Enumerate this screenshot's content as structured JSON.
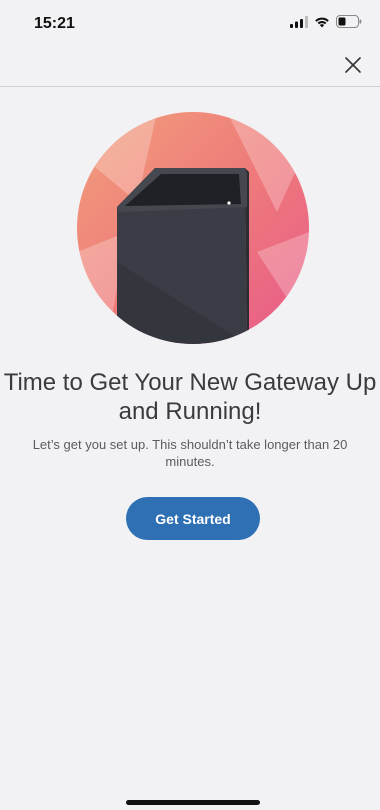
{
  "status_bar": {
    "time": "15:21",
    "icons": [
      "signal-icon",
      "wifi-icon",
      "battery-icon"
    ]
  },
  "header": {
    "close_icon": "close-icon"
  },
  "hero": {
    "image": "gateway-illustration",
    "colors": {
      "circle_start": "#f08a6a",
      "circle_end": "#ea5f86",
      "device_body": "#3a3d45",
      "device_top": "#22242a"
    }
  },
  "content": {
    "title": "Time to Get Your New Gateway Up and Running!",
    "subtitle": "Let’s get you set up. This shouldn’t take longer than 20 minutes.",
    "cta_label": "Get Started"
  },
  "colors": {
    "background": "#f2f2f4",
    "accent": "#2f6fb3"
  }
}
